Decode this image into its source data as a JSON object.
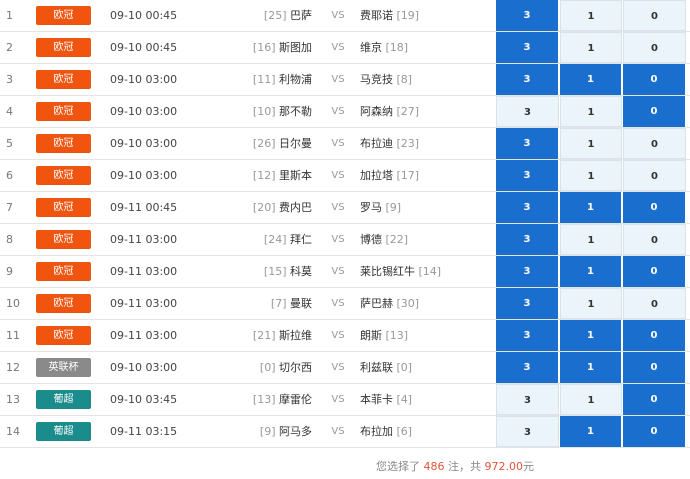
{
  "colors": {
    "ucl": "#f0540f",
    "cup": "#8a8a8a",
    "portugal": "#1a8c8c",
    "selected": "#1a6fce",
    "unselected": "#ecf4fb"
  },
  "rows": [
    {
      "idx": "1",
      "league": "欧冠",
      "league_type": "ucl",
      "time": "09-10 00:45",
      "home_rank": "[25]",
      "home": "巴萨",
      "vs": "VS",
      "away": "费耶诺",
      "away_rank": "[19]",
      "o3": "3",
      "o1": "1",
      "o0": "0",
      "sel": [
        true,
        false,
        false
      ]
    },
    {
      "idx": "2",
      "league": "欧冠",
      "league_type": "ucl",
      "time": "09-10 00:45",
      "home_rank": "[16]",
      "home": "斯图加",
      "vs": "VS",
      "away": "维京",
      "away_rank": "[18]",
      "o3": "3",
      "o1": "1",
      "o0": "0",
      "sel": [
        true,
        false,
        false
      ]
    },
    {
      "idx": "3",
      "league": "欧冠",
      "league_type": "ucl",
      "time": "09-10 03:00",
      "home_rank": "[11]",
      "home": "利物浦",
      "vs": "VS",
      "away": "马竞技",
      "away_rank": "[8]",
      "o3": "3",
      "o1": "1",
      "o0": "0",
      "sel": [
        true,
        true,
        true
      ]
    },
    {
      "idx": "4",
      "league": "欧冠",
      "league_type": "ucl",
      "time": "09-10 03:00",
      "home_rank": "[10]",
      "home": "那不勒",
      "vs": "VS",
      "away": "阿森纳",
      "away_rank": "[27]",
      "o3": "3",
      "o1": "1",
      "o0": "0",
      "sel": [
        false,
        false,
        true
      ]
    },
    {
      "idx": "5",
      "league": "欧冠",
      "league_type": "ucl",
      "time": "09-10 03:00",
      "home_rank": "[26]",
      "home": "日尔曼",
      "vs": "VS",
      "away": "布拉迪",
      "away_rank": "[23]",
      "o3": "3",
      "o1": "1",
      "o0": "0",
      "sel": [
        true,
        false,
        false
      ]
    },
    {
      "idx": "6",
      "league": "欧冠",
      "league_type": "ucl",
      "time": "09-10 03:00",
      "home_rank": "[12]",
      "home": "里斯本",
      "vs": "VS",
      "away": "加拉塔",
      "away_rank": "[17]",
      "o3": "3",
      "o1": "1",
      "o0": "0",
      "sel": [
        true,
        false,
        false
      ]
    },
    {
      "idx": "7",
      "league": "欧冠",
      "league_type": "ucl",
      "time": "09-11 00:45",
      "home_rank": "[20]",
      "home": "费内巴",
      "vs": "VS",
      "away": "罗马",
      "away_rank": "[9]",
      "o3": "3",
      "o1": "1",
      "o0": "0",
      "sel": [
        true,
        true,
        true
      ]
    },
    {
      "idx": "8",
      "league": "欧冠",
      "league_type": "ucl",
      "time": "09-11 03:00",
      "home_rank": "[24]",
      "home": "拜仁",
      "vs": "VS",
      "away": "博德",
      "away_rank": "[22]",
      "o3": "3",
      "o1": "1",
      "o0": "0",
      "sel": [
        true,
        false,
        false
      ]
    },
    {
      "idx": "9",
      "league": "欧冠",
      "league_type": "ucl",
      "time": "09-11 03:00",
      "home_rank": "[15]",
      "home": "科莫",
      "vs": "VS",
      "away": "莱比锡红牛",
      "away_rank": "[14]",
      "o3": "3",
      "o1": "1",
      "o0": "0",
      "sel": [
        true,
        true,
        true
      ]
    },
    {
      "idx": "10",
      "league": "欧冠",
      "league_type": "ucl",
      "time": "09-11 03:00",
      "home_rank": "[7]",
      "home": "曼联",
      "vs": "VS",
      "away": "萨巴赫",
      "away_rank": "[30]",
      "o3": "3",
      "o1": "1",
      "o0": "0",
      "sel": [
        true,
        false,
        false
      ]
    },
    {
      "idx": "11",
      "league": "欧冠",
      "league_type": "ucl",
      "time": "09-11 03:00",
      "home_rank": "[21]",
      "home": "斯拉维",
      "vs": "VS",
      "away": "朗斯",
      "away_rank": "[13]",
      "o3": "3",
      "o1": "1",
      "o0": "0",
      "sel": [
        true,
        true,
        true
      ]
    },
    {
      "idx": "12",
      "league": "英联杯",
      "league_type": "cup",
      "time": "09-10 03:00",
      "home_rank": "[0]",
      "home": "切尔西",
      "vs": "VS",
      "away": "利兹联",
      "away_rank": "[0]",
      "o3": "3",
      "o1": "1",
      "o0": "0",
      "sel": [
        true,
        true,
        true
      ]
    },
    {
      "idx": "13",
      "league": "葡超",
      "league_type": "portugal",
      "time": "09-10 03:45",
      "home_rank": "[13]",
      "home": "摩雷伦",
      "vs": "VS",
      "away": "本菲卡",
      "away_rank": "[4]",
      "o3": "3",
      "o1": "1",
      "o0": "0",
      "sel": [
        false,
        false,
        true
      ]
    },
    {
      "idx": "14",
      "league": "葡超",
      "league_type": "portugal",
      "time": "09-11 03:15",
      "home_rank": "[9]",
      "home": "阿马多",
      "vs": "VS",
      "away": "布拉加",
      "away_rank": "[6]",
      "o3": "3",
      "o1": "1",
      "o0": "0",
      "sel": [
        false,
        true,
        true
      ]
    }
  ],
  "footer": {
    "prefix": "您选择了 ",
    "count": "486",
    "middle": " 注，共 ",
    "amount": "972.00",
    "suffix": "元"
  }
}
